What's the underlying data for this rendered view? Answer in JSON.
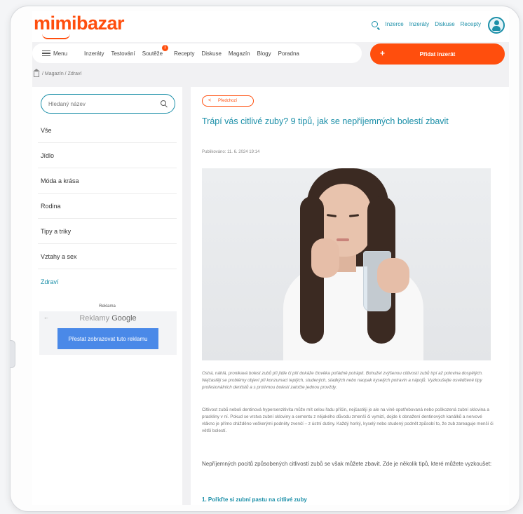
{
  "header": {
    "logo": "mimibazar",
    "links": [
      "Inzerce",
      "Inzeráty",
      "Diskuse",
      "Recepty"
    ]
  },
  "nav": {
    "menu_label": "Menu",
    "items": [
      "Inzeráty",
      "Testování",
      "Soutěže",
      "Recepty",
      "Diskuse",
      "Magazín",
      "Blogy",
      "Poradna"
    ],
    "badge": "1",
    "add_button": "Přidat inzerát"
  },
  "breadcrumb": "/ Magazín / Zdraví",
  "sidebar": {
    "search_placeholder": "Hledaný název",
    "categories": [
      "Vše",
      "Jídlo",
      "Móda a krása",
      "Rodina",
      "Tipy a triky",
      "Vztahy a sex",
      "Zdraví"
    ],
    "ad_label": "Reklama",
    "ad_brand_prefix": "Reklamy",
    "ad_brand": "Google",
    "ad_stop": "Přestat zobrazovat tuto reklamu"
  },
  "article": {
    "back_label": "Předchozí",
    "title": "Trápí vás citlivé zuby? 9 tipů, jak se nepříjemných bolestí zbavit",
    "published": "Publikováno: 11. 6. 2024 19:14",
    "p1": "Ostrá, náhlá, pronikavá bolest zubů při jídle či pití dokáže člověka pořádně potrápit. Bohužel zvýšenou citlivostí zubů trpí až polovina dospělých. Nejčastěji se problémy objeví při konzumaci teplých, studených, sladkých nebo naopak kyselých potravin a nápojů. Vyzkoušejte osvědčené tipy profesionálních dentistů a s protivnou bolestí zatočte jednou provždy.",
    "p2": "Citlivost zubů neboli dentinová hypersenzitivita může mít celou řadu příčin, nejčastěji je ale na vině opotřebovaná nebo poškozená zubní sklovina a praskliny v ní. Pokud se vrstva zubní skloviny a cementu z nějakého důvodu zmenší či vymizí, dojde k obnažení dentinových kanálků a nervové vlákno je přímo drážděno veškerými podněty zvenčí – z ústní dutiny. Každý horký, kyselý nebo studený podnět způsobí to, že zub zareaguje menší či větší bolestí.",
    "p3": "Nepříjemných pocitů způsobených citlivostí zubů se však můžete zbavit. Zde je několik tipů, které můžete vyzkoušet:",
    "subhead": "1. Pořiďte si zubní pastu na citlivé zuby"
  },
  "colors": {
    "brand_orange": "#ff4e0d",
    "teal": "#1b8fa8",
    "ad_blue": "#4a89e8"
  }
}
